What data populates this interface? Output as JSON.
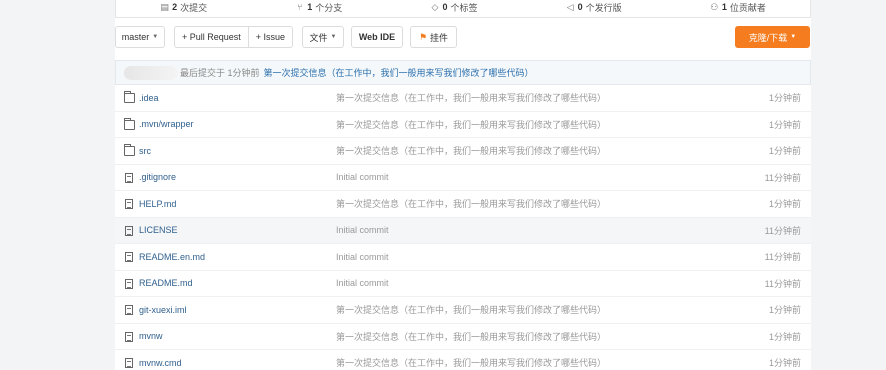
{
  "stats": {
    "commits": {
      "count": "2",
      "label": "次提交"
    },
    "branches": {
      "count": "1",
      "label": "个分支"
    },
    "tags": {
      "count": "0",
      "label": "个标签"
    },
    "releases": {
      "count": "0",
      "label": "个发行版"
    },
    "contributors": {
      "count": "1",
      "label": "位贡献者"
    }
  },
  "toolbar": {
    "branch": "master",
    "pull_request": "+ Pull Request",
    "issue": "+ Issue",
    "file_menu": "文件",
    "web_ide": "Web IDE",
    "bookmark": "挂件",
    "clone_download": "克隆/下载"
  },
  "last_commit": {
    "meta": "最后提交于 1分钟前",
    "message": "第一次提交信息（在工作中，我们一般用来写我们修改了哪些代码）"
  },
  "files": [
    {
      "name": ".idea",
      "type": "folder",
      "message": "第一次提交信息（在工作中，我们一般用来写我们修改了哪些代码）",
      "time": "1分钟前"
    },
    {
      "name": ".mvn/wrapper",
      "type": "folder",
      "message": "第一次提交信息（在工作中，我们一般用来写我们修改了哪些代码）",
      "time": "1分钟前"
    },
    {
      "name": "src",
      "type": "folder",
      "message": "第一次提交信息（在工作中，我们一般用来写我们修改了哪些代码）",
      "time": "1分钟前"
    },
    {
      "name": ".gitignore",
      "type": "file",
      "message": "Initial commit",
      "time": "11分钟前"
    },
    {
      "name": "HELP.md",
      "type": "file",
      "message": "第一次提交信息（在工作中，我们一般用来写我们修改了哪些代码）",
      "time": "1分钟前"
    },
    {
      "name": "LICENSE",
      "type": "file",
      "message": "Initial commit",
      "time": "11分钟前"
    },
    {
      "name": "README.en.md",
      "type": "file",
      "message": "Initial commit",
      "time": "11分钟前"
    },
    {
      "name": "README.md",
      "type": "file",
      "message": "Initial commit",
      "time": "11分钟前"
    },
    {
      "name": "git-xuexi.iml",
      "type": "file",
      "message": "第一次提交信息（在工作中，我们一般用来写我们修改了哪些代码）",
      "time": "1分钟前"
    },
    {
      "name": "mvnw",
      "type": "file",
      "message": "第一次提交信息（在工作中，我们一般用来写我们修改了哪些代码）",
      "time": "1分钟前"
    },
    {
      "name": "mvnw.cmd",
      "type": "file",
      "message": "第一次提交信息（在工作中，我们一般用来写我们修改了哪些代码）",
      "time": "1分钟前"
    }
  ],
  "colors": {
    "accent": "#f57c1f",
    "link": "#2e5f8c",
    "commit_link": "#2a6fad"
  }
}
